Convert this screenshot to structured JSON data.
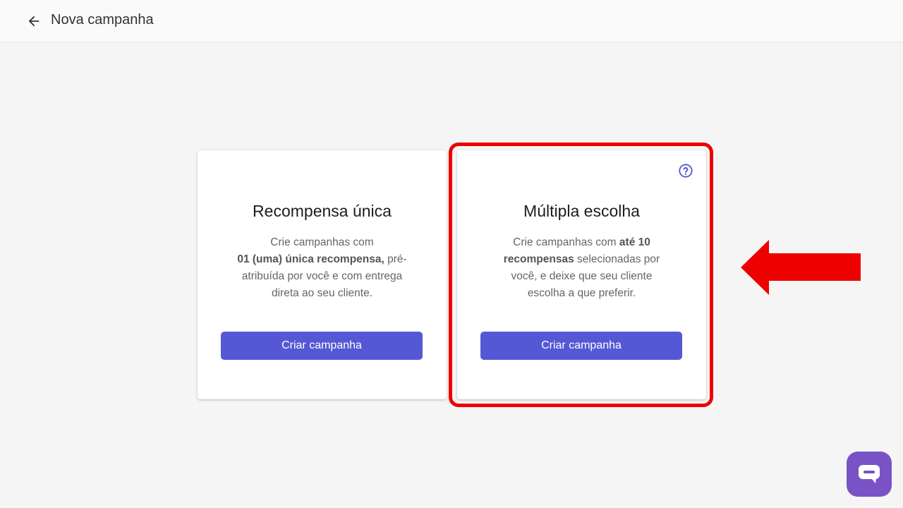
{
  "header": {
    "back_icon": "arrow-left-icon",
    "title": "Nova campanha"
  },
  "cards": [
    {
      "title": "Recompensa única",
      "desc": [
        {
          "text": "Crie campanhas com ",
          "bold": false
        },
        {
          "text": "01 (uma) única recompensa,",
          "bold": true
        },
        {
          "text": " pré-atribuída por você e com entrega direta ao seu cliente.",
          "bold": false
        }
      ],
      "button_label": "Criar campanha"
    },
    {
      "title": "Múltipla escolha",
      "help_icon": "help-circle-icon",
      "desc": [
        {
          "text": "Crie campanhas com ",
          "bold": false
        },
        {
          "text": "até 10 recompensas",
          "bold": true
        },
        {
          "text": " selecionadas por você, e deixe que seu cliente escolha a que preferir.",
          "bold": false
        }
      ],
      "button_label": "Criar campanha"
    }
  ],
  "annotation": {
    "highlight_color": "#ee0000",
    "arrow_icon": "arrow-left-pointer-icon"
  },
  "chat": {
    "icon": "chat-bubble-icon",
    "color": "#7953c6"
  },
  "colors": {
    "primary": "#5558d4",
    "background": "#f5f5f5"
  }
}
